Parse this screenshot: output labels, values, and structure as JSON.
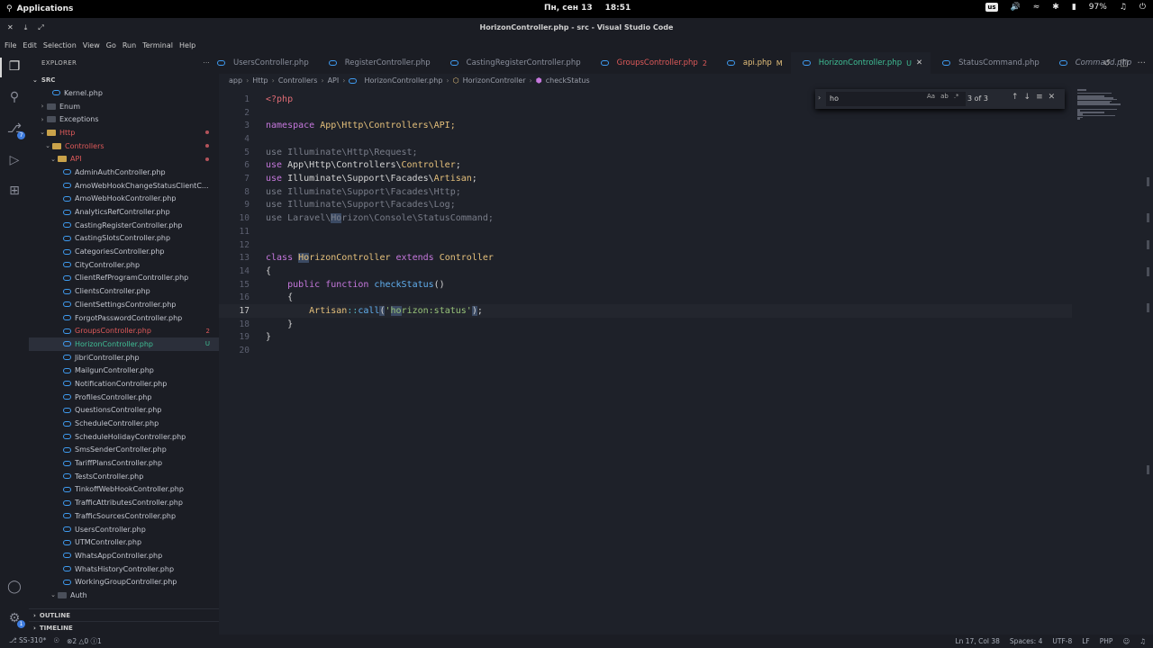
{
  "system": {
    "apps_label": "Applications",
    "date": "Пн, сен 13",
    "time": "18:51",
    "keyboard_layout": "us",
    "battery": "97%"
  },
  "window": {
    "title": "HorizonController.php - src - Visual Studio Code"
  },
  "menu": [
    "File",
    "Edit",
    "Selection",
    "View",
    "Go",
    "Run",
    "Terminal",
    "Help"
  ],
  "activity_bar": {
    "badge_source_control": "7",
    "badge_settings": "1"
  },
  "explorer": {
    "header": "EXPLORER",
    "root": "SRC",
    "outline": "OUTLINE",
    "timeline": "TIMELINE",
    "tree": [
      {
        "label": "Kernel.php",
        "kind": "file",
        "indent": 2
      },
      {
        "label": "Enum",
        "kind": "folder",
        "indent": 1,
        "chev": ">"
      },
      {
        "label": "Exceptions",
        "kind": "folder",
        "indent": 1,
        "chev": ">"
      },
      {
        "label": "Http",
        "kind": "folder-open",
        "indent": 1,
        "chev": "v",
        "color": "#e05a5a",
        "dot": true
      },
      {
        "label": "Controllers",
        "kind": "folder-open",
        "indent": 2,
        "chev": "v",
        "color": "#e05a5a",
        "dot": true
      },
      {
        "label": "API",
        "kind": "folder-open",
        "indent": 3,
        "chev": "v",
        "color": "#e05a5a",
        "dot": true
      },
      {
        "label": "AdminAuthController.php",
        "kind": "file",
        "indent": 4
      },
      {
        "label": "AmoWebHookChangeStatusClientC...",
        "kind": "file",
        "indent": 4
      },
      {
        "label": "AmoWebHookController.php",
        "kind": "file",
        "indent": 4
      },
      {
        "label": "AnalyticsRefController.php",
        "kind": "file",
        "indent": 4
      },
      {
        "label": "CastingRegisterController.php",
        "kind": "file",
        "indent": 4
      },
      {
        "label": "CastingSlotsController.php",
        "kind": "file",
        "indent": 4
      },
      {
        "label": "CategoriesController.php",
        "kind": "file",
        "indent": 4
      },
      {
        "label": "CityController.php",
        "kind": "file",
        "indent": 4
      },
      {
        "label": "ClientRefProgramController.php",
        "kind": "file",
        "indent": 4
      },
      {
        "label": "ClientsController.php",
        "kind": "file",
        "indent": 4
      },
      {
        "label": "ClientSettingsController.php",
        "kind": "file",
        "indent": 4
      },
      {
        "label": "ForgotPasswordController.php",
        "kind": "file",
        "indent": 4
      },
      {
        "label": "GroupsController.php",
        "kind": "file",
        "indent": 4,
        "color": "#e05a5a",
        "badge": "2",
        "badge_color": "#e05a5a"
      },
      {
        "label": "HorizonController.php",
        "kind": "file",
        "indent": 4,
        "color": "#3fbf95",
        "badge": "U",
        "badge_color": "#3fbf95",
        "selected": true
      },
      {
        "label": "JibriController.php",
        "kind": "file",
        "indent": 4
      },
      {
        "label": "MailgunController.php",
        "kind": "file",
        "indent": 4
      },
      {
        "label": "NotificationController.php",
        "kind": "file",
        "indent": 4
      },
      {
        "label": "ProfilesController.php",
        "kind": "file",
        "indent": 4
      },
      {
        "label": "QuestionsController.php",
        "kind": "file",
        "indent": 4
      },
      {
        "label": "ScheduleController.php",
        "kind": "file",
        "indent": 4
      },
      {
        "label": "ScheduleHolidayController.php",
        "kind": "file",
        "indent": 4
      },
      {
        "label": "SmsSenderController.php",
        "kind": "file",
        "indent": 4
      },
      {
        "label": "TariffPlansController.php",
        "kind": "file",
        "indent": 4
      },
      {
        "label": "TestsController.php",
        "kind": "file",
        "indent": 4
      },
      {
        "label": "TinkoffWebHookController.php",
        "kind": "file",
        "indent": 4
      },
      {
        "label": "TrafficAttributesController.php",
        "kind": "file",
        "indent": 4
      },
      {
        "label": "TrafficSourcesController.php",
        "kind": "file",
        "indent": 4
      },
      {
        "label": "UsersController.php",
        "kind": "file",
        "indent": 4
      },
      {
        "label": "UTMController.php",
        "kind": "file",
        "indent": 4
      },
      {
        "label": "WhatsAppController.php",
        "kind": "file",
        "indent": 4
      },
      {
        "label": "WhatsHistoryController.php",
        "kind": "file",
        "indent": 4
      },
      {
        "label": "WorkingGroupController.php",
        "kind": "file",
        "indent": 4
      },
      {
        "label": "Auth",
        "kind": "folder",
        "indent": 3,
        "chev": "v"
      }
    ]
  },
  "tabs": [
    {
      "label": "UsersController.php",
      "badge": "",
      "color": "#8a8f9c"
    },
    {
      "label": "RegisterController.php",
      "badge": "",
      "color": "#8a8f9c"
    },
    {
      "label": "CastingRegisterController.php",
      "badge": "",
      "color": "#8a8f9c"
    },
    {
      "label": "GroupsController.php",
      "badge": "2",
      "color": "#e05a5a"
    },
    {
      "label": "api.php",
      "badge": "M",
      "color": "#e5c07b"
    },
    {
      "label": "HorizonController.php",
      "badge": "U",
      "color": "#3fbf95",
      "active": true
    },
    {
      "label": "StatusCommand.php",
      "badge": "",
      "color": "#8a8f9c"
    },
    {
      "label": "Command.php",
      "badge": "",
      "color": "#8a8f9c",
      "italic": true
    }
  ],
  "breadcrumbs": [
    "app",
    "Http",
    "Controllers",
    "API",
    "HorizonController.php",
    "HorizonController",
    "checkStatus"
  ],
  "find_widget": {
    "query": "ho",
    "match_case": "Aa",
    "whole_word": "ab",
    "regex": ".*",
    "count": "3 of 3"
  },
  "code_lines": [
    [
      {
        "t": "<?php",
        "c": "tag"
      }
    ],
    [],
    [
      {
        "t": "namespace",
        "c": "kw"
      },
      {
        "t": " App\\Http\\Controllers\\API;",
        "c": "cls"
      }
    ],
    [],
    [
      {
        "t": "use",
        "c": "dim"
      },
      {
        "t": " Illuminate\\Http\\Request;",
        "c": "dim"
      }
    ],
    [
      {
        "t": "use",
        "c": "kw"
      },
      {
        "t": " App\\Http\\Controllers\\",
        "c": "ns"
      },
      {
        "t": "Controller",
        "c": "cls"
      },
      {
        "t": ";",
        "c": "ns"
      }
    ],
    [
      {
        "t": "use",
        "c": "kw"
      },
      {
        "t": " Illuminate\\Support\\Facades\\",
        "c": "ns"
      },
      {
        "t": "Artisan",
        "c": "cls"
      },
      {
        "t": ";",
        "c": "ns"
      }
    ],
    [
      {
        "t": "use",
        "c": "dim"
      },
      {
        "t": " Illuminate\\Support\\Facades\\Http;",
        "c": "dim"
      }
    ],
    [
      {
        "t": "use",
        "c": "dim"
      },
      {
        "t": " Illuminate\\Support\\Facades\\Log;",
        "c": "dim"
      }
    ],
    [
      {
        "t": "use",
        "c": "dim"
      },
      {
        "t": " Laravel\\",
        "c": "dim"
      },
      {
        "t": "Ho",
        "c": "dim",
        "hl": true
      },
      {
        "t": "rizon\\Console\\StatusCommand;",
        "c": "dim"
      }
    ],
    [],
    [],
    [
      {
        "t": "class",
        "c": "kw"
      },
      {
        "t": " ",
        "c": "ns"
      },
      {
        "t": "Ho",
        "c": "cls",
        "hl": true
      },
      {
        "t": "rizonController",
        "c": "cls"
      },
      {
        "t": " extends",
        "c": "kw"
      },
      {
        "t": " Controller",
        "c": "cls"
      }
    ],
    [
      {
        "t": "{",
        "c": "ns"
      }
    ],
    [
      {
        "t": "    public",
        "c": "kw"
      },
      {
        "t": " function",
        "c": "kw"
      },
      {
        "t": " checkStatus",
        "c": "fn"
      },
      {
        "t": "()",
        "c": "ns"
      }
    ],
    [
      {
        "t": "    {",
        "c": "ns"
      }
    ],
    [
      {
        "t": "        Artisan",
        "c": "cls"
      },
      {
        "t": "::",
        "c": "op"
      },
      {
        "t": "call",
        "c": "fn"
      },
      {
        "t": "(",
        "c": "ns",
        "hl": true
      },
      {
        "t": "'",
        "c": "str"
      },
      {
        "t": "ho",
        "c": "str",
        "hl": true
      },
      {
        "t": "rizon:status'",
        "c": "str"
      },
      {
        "t": ")",
        "c": "ns",
        "hl": true
      },
      {
        "t": ";",
        "c": "ns"
      }
    ],
    [
      {
        "t": "    }",
        "c": "ns"
      }
    ],
    [
      {
        "t": "}",
        "c": "ns"
      }
    ],
    []
  ],
  "current_line": 17,
  "status": {
    "branch": "SS-310*",
    "errors": "2",
    "warnings": "0",
    "infos": "1",
    "position": "Ln 17, Col 38",
    "spaces": "Spaces: 4",
    "encoding": "UTF-8",
    "eol": "LF",
    "language": "PHP"
  }
}
